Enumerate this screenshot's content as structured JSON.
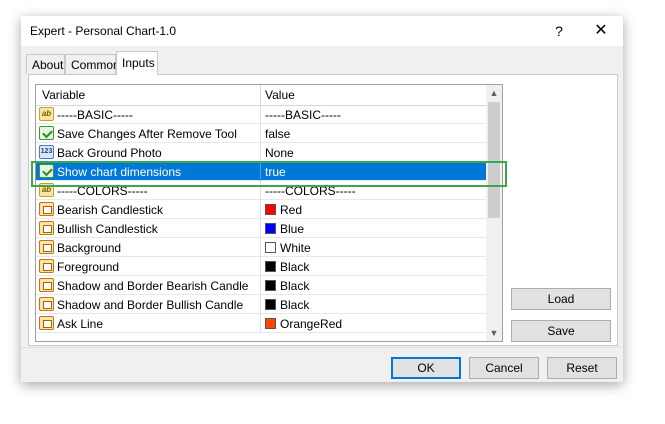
{
  "window": {
    "title": "Expert - Personal Chart-1.0",
    "help_glyph": "?",
    "close_glyph": "✕"
  },
  "tabs": [
    {
      "label": "About",
      "active": false
    },
    {
      "label": "Common",
      "active": false
    },
    {
      "label": "Inputs",
      "active": true
    }
  ],
  "grid": {
    "columns": [
      "Variable",
      "Value"
    ],
    "selected_index": 3,
    "rows": [
      {
        "icon": "abc-icon",
        "variable": "-----BASIC-----",
        "value": "-----BASIC-----"
      },
      {
        "icon": "bool-icon",
        "variable": "Save Changes After Remove Tool",
        "value": "false"
      },
      {
        "icon": "number-icon",
        "variable": "Back Ground Photo",
        "value": "None"
      },
      {
        "icon": "bool-icon",
        "variable": "Show chart dimensions",
        "value": "true"
      },
      {
        "icon": "abc-icon",
        "variable": "-----COLORS-----",
        "value": "-----COLORS-----"
      },
      {
        "icon": "color-icon",
        "variable": "Bearish Candlestick",
        "value": "Red",
        "swatch": "#ff0000"
      },
      {
        "icon": "color-icon",
        "variable": "Bullish Candlestick",
        "value": "Blue",
        "swatch": "#0000ff"
      },
      {
        "icon": "color-icon",
        "variable": "Background",
        "value": "White",
        "swatch": "#ffffff"
      },
      {
        "icon": "color-icon",
        "variable": "Foreground",
        "value": "Black",
        "swatch": "#000000"
      },
      {
        "icon": "color-icon",
        "variable": "Shadow and Border Bearish Candle",
        "value": "Black",
        "swatch": "#000000"
      },
      {
        "icon": "color-icon",
        "variable": "Shadow and Border Bullish Candle",
        "value": "Black",
        "swatch": "#000000"
      },
      {
        "icon": "color-icon",
        "variable": "Ask Line",
        "value": "OrangeRed",
        "swatch": "#ff4500"
      }
    ]
  },
  "side_buttons": {
    "load": "Load",
    "save": "Save"
  },
  "footer_buttons": {
    "ok": "OK",
    "cancel": "Cancel",
    "reset": "Reset"
  },
  "colors": {
    "selection": "#0078d7",
    "highlight_frame": "#3aa84a"
  }
}
